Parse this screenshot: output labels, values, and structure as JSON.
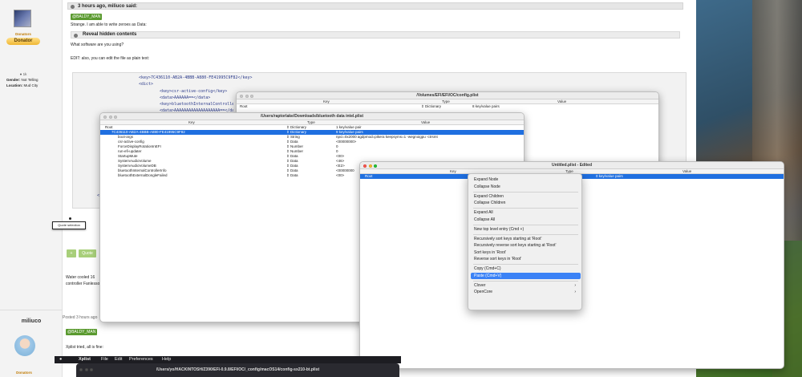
{
  "forum": {
    "quote_header": "3 hours ago, miliuco said:",
    "mention1": "@BALDY_MAN",
    "line1": "Strange. I am able to write zeroes as Data:",
    "reveal": "Reveal hidden contents",
    "line2": "What software are you using?",
    "line3": "EDIT: also, you can edit the file as plain text:",
    "code_lines": [
      "<key>7C436110-AB2A-4BBB-A880-FE41995C9F82</key>",
      "<dict>",
      "<key>csr-active-config</key>",
      "<data>AAAAAA==</data>",
      "<key>bluetoothInternalControllerInfo</key>",
      "<data>AAAAAAAAAAAAAAAAAAA==</data>"
    ],
    "code_stub": "<",
    "quote_selection": "Quote selection",
    "quote_btn": "Quote",
    "plus_btn": "+",
    "tail1": "Water cooled 16",
    "tail2": "controller  Fanlesso",
    "user1": {
      "role": "Donators",
      "badge": "Donator",
      "count": "1k",
      "gender_label": "Gender:",
      "gender": "Not Telling",
      "location_label": "Location:",
      "location": "Mud City"
    },
    "user2": {
      "name": "miliuco",
      "posted": "Posted 3 hours ago",
      "mention": "@BALDY_MAN",
      "message": "Xplist tried, all is fine:",
      "role": "Donators"
    }
  },
  "win_config": {
    "title": "/Volumes/EFI/EFI/OC/config.plist",
    "headers": [
      "Key",
      "Type",
      "Value"
    ],
    "root": {
      "key": "Root",
      "type": "Dictionary",
      "value": "8 key/value pairs"
    }
  },
  "win_bt": {
    "title": "/Users/raptorlake/Downloads/bluetooth data intel.plist",
    "headers": [
      "Key",
      "Type",
      "Value"
    ],
    "rows": [
      {
        "key": "Root",
        "type": "Dictionary",
        "value": "1 key/value pair",
        "indent": 0,
        "sel": false
      },
      {
        "key": "7C436110-AB2A-4BBB-A880-FE41995C9F82",
        "type": "Dictionary",
        "value": "9 key/value pairs",
        "indent": 1,
        "sel": true
      },
      {
        "key": "boot-args",
        "type": "String",
        "value": "npci=0x2000 agdpmod=pikera keepsyms=1 -wegnoigpu -ctrsmt",
        "indent": 2,
        "sel": false
      },
      {
        "key": "csr-active-config",
        "type": "Data",
        "value": "<00000000>",
        "indent": 2,
        "sel": false
      },
      {
        "key": "ForceDisplayRotationInEFI",
        "type": "Number",
        "value": "0",
        "indent": 2,
        "sel": false
      },
      {
        "key": "run-efi-updater",
        "type": "Number",
        "value": "0",
        "indent": 2,
        "sel": false
      },
      {
        "key": "StartupMute",
        "type": "Data",
        "value": "<00>",
        "indent": 2,
        "sel": false
      },
      {
        "key": "SystemAudioVolume",
        "type": "Data",
        "value": "<46>",
        "indent": 2,
        "sel": false
      },
      {
        "key": "SystemAudioVolumeDB",
        "type": "Data",
        "value": "<E2>",
        "indent": 2,
        "sel": false
      },
      {
        "key": "bluetoothInternalControllerInfo",
        "type": "Data",
        "value": "<00000000",
        "indent": 2,
        "sel": false
      },
      {
        "key": "bluetoothExternalDongleFailed",
        "type": "Data",
        "value": "<00>",
        "indent": 2,
        "sel": false
      }
    ]
  },
  "win_untitled": {
    "title": "Untitled.plist - Edited",
    "headers": [
      "Key",
      "Type",
      "Value"
    ],
    "root": {
      "key": "Root",
      "value": "0 key/value pairs"
    }
  },
  "context_menu": {
    "items": [
      {
        "label": "Expand Node",
        "hl": false,
        "sub": false,
        "sep_before": false
      },
      {
        "label": "Collapse Node",
        "hl": false,
        "sub": false,
        "sep_before": false
      },
      {
        "label": "Expand Children",
        "hl": false,
        "sub": false,
        "sep_before": true
      },
      {
        "label": "Collapse Children",
        "hl": false,
        "sub": false,
        "sep_before": false
      },
      {
        "label": "Expand All",
        "hl": false,
        "sub": false,
        "sep_before": true
      },
      {
        "label": "Collapse All",
        "hl": false,
        "sub": false,
        "sep_before": false
      },
      {
        "label": "New top level entry (Cmd +)",
        "hl": false,
        "sub": false,
        "sep_before": true
      },
      {
        "label": "Recursively sort keys starting at 'Root'",
        "hl": false,
        "sub": false,
        "sep_before": true
      },
      {
        "label": "Recursively reverse sort keys starting at 'Root'",
        "hl": false,
        "sub": false,
        "sep_before": false
      },
      {
        "label": "Sort keys in 'Root'",
        "hl": false,
        "sub": false,
        "sep_before": false
      },
      {
        "label": "Reverse sort keys in 'Root'",
        "hl": false,
        "sub": false,
        "sep_before": false
      },
      {
        "label": "Copy (Cmd+C)",
        "hl": false,
        "sub": false,
        "sep_before": true
      },
      {
        "label": "Paste (Cmd+V)",
        "hl": true,
        "sub": false,
        "sep_before": false
      },
      {
        "label": "Clover",
        "hl": false,
        "sub": true,
        "sep_before": true
      },
      {
        "label": "OpenCore",
        "hl": false,
        "sub": true,
        "sep_before": false
      }
    ],
    "chevron": "›"
  },
  "menubar": {
    "apple": "",
    "items": [
      "Xplist",
      "File",
      "Edit",
      "Preferences",
      "Help"
    ],
    "path": "/Users/yo/HACKINTOSH/Z390/EFI-0.9.8/EFI/OC/_config/macOS14/config-sx210-bt.plist"
  },
  "colors": {
    "selection": "#1f6fe0",
    "menu_highlight": "#3b82f6",
    "forum_tag": "#5a9a2f"
  }
}
